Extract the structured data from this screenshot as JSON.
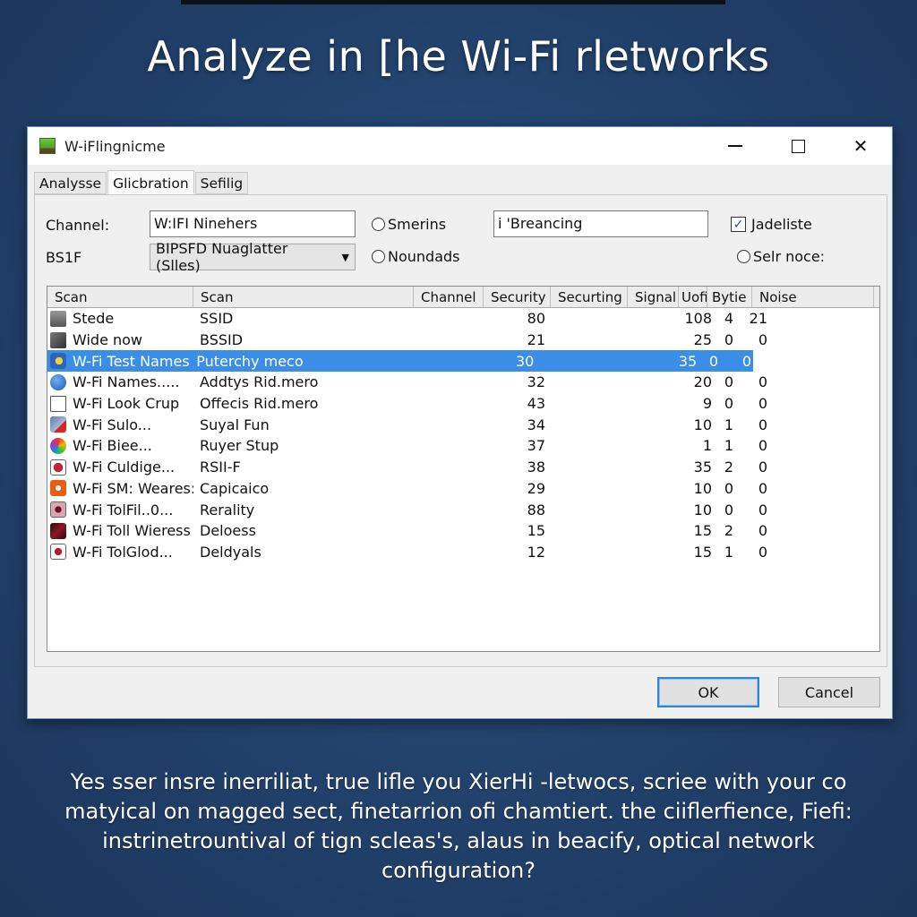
{
  "headline": "Analyze in [he Wi-Fi rletworks",
  "window": {
    "title": "W-iFlingnicme",
    "controls": {
      "minimize": "minimize",
      "maximize": "maximize",
      "close": "✕"
    }
  },
  "tabs": [
    {
      "label": "Analysse",
      "active": false
    },
    {
      "label": "Glicbration",
      "active": true
    },
    {
      "label": "Sefilig",
      "active": false
    }
  ],
  "form": {
    "channel_label": "Channel:",
    "channel_value": "W:IFI Ninehers",
    "bssid_label": "BS1F",
    "bssid_combo_value": "BIPSFD Nuaglatter (Slles)",
    "radio_smering": "Smerins",
    "radio_noundads": "Noundads",
    "search_value": "i 'Breancing",
    "check_label": "Jadeliste",
    "check_checked": true,
    "radio_selr": "Selr noce:"
  },
  "table": {
    "columns": [
      "Scan",
      "Scan",
      "Channel",
      "Security",
      "Securting",
      "Signal",
      "Uofi",
      "Bytie",
      "Noise"
    ],
    "rows": [
      {
        "icon": "router-icon",
        "name": "Stede",
        "ssid": "SSID",
        "channel": "80",
        "signal": "108",
        "uofi": "4",
        "byte": "21",
        "selected": false
      },
      {
        "icon": "antenna-icon",
        "name": "Wide now",
        "ssid": "BSSID",
        "channel": "21",
        "signal": "25",
        "uofi": "0",
        "byte": "0",
        "selected": false
      },
      {
        "icon": "globe-icon",
        "name": "W-Fi Test Names",
        "ssid": "Puterchy meco",
        "channel": "30",
        "signal": "35",
        "uofi": "0",
        "byte": "0",
        "selected": true
      },
      {
        "icon": "info-globe-icon",
        "name": "W-Fi Names.....",
        "ssid": "Addtys Rid.mero",
        "channel": "32",
        "signal": "20",
        "uofi": "0",
        "byte": "0",
        "selected": false
      },
      {
        "icon": "blank-page-icon",
        "name": "W-Fi Look Crup",
        "ssid": "Offecis Rid.mero",
        "channel": "43",
        "signal": "9",
        "uofi": "0",
        "byte": "0",
        "selected": false
      },
      {
        "icon": "network-pin-icon",
        "name": "W-Fi Sulo...",
        "ssid": "Suyal Fun",
        "channel": "34",
        "signal": "10",
        "uofi": "1",
        "byte": "0",
        "selected": false
      },
      {
        "icon": "color-wheel-icon",
        "name": "W-Fi Biee...",
        "ssid": "Ruyer Stup",
        "channel": "37",
        "signal": "1",
        "uofi": "1",
        "byte": "0",
        "selected": false
      },
      {
        "icon": "shield-icon",
        "name": "W-Fi Culdige...",
        "ssid": "RSII-F",
        "channel": "38",
        "signal": "35",
        "uofi": "2",
        "byte": "0",
        "selected": false
      },
      {
        "icon": "orange-app-icon",
        "name": "W-Fi SM: Weares:",
        "ssid": "Capicaico",
        "channel": "29",
        "signal": "10",
        "uofi": "0",
        "byte": "0",
        "selected": false
      },
      {
        "icon": "pink-app-icon",
        "name": "W-Fi TolFil..0...",
        "ssid": "Rerality",
        "channel": "88",
        "signal": "10",
        "uofi": "0",
        "byte": "0",
        "selected": false
      },
      {
        "icon": "dark-red-app-icon",
        "name": "W-Fi Toll Wieress",
        "ssid": "Deloess",
        "channel": "15",
        "signal": "15",
        "uofi": "2",
        "byte": "0",
        "selected": false
      },
      {
        "icon": "red-app-icon",
        "name": "W-Fi TolGlod...",
        "ssid": "Deldyals",
        "channel": "12",
        "signal": "15",
        "uofi": "1",
        "byte": "0",
        "selected": false
      }
    ]
  },
  "buttons": {
    "ok": "OK",
    "cancel": "Cancel"
  },
  "caption": "Yes sser insre inerriliat, true lifle you XierHi -letwocs, scriee with your co matyical on magged sect, finetarrion ofi chamtiert. the ciiflerfience, Fiefi: instrinetrountival of tign scleas's, alaus in beacify, optical network configuration?",
  "colors": {
    "background": "#23446e",
    "selection": "#3a8ee8",
    "default_button_border": "#2f86d6"
  }
}
